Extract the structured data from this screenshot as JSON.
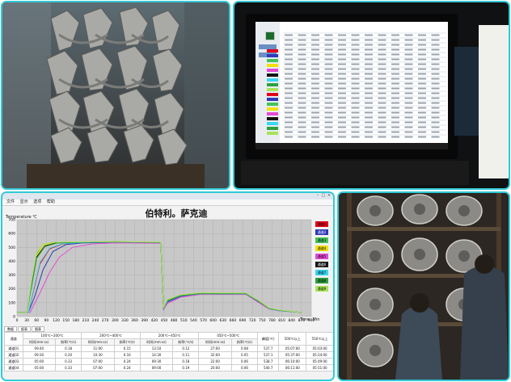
{
  "chart_window": {
    "titlebar_text": "",
    "menu_items": [
      "文件",
      "显示",
      "选项",
      "帮助"
    ],
    "chart_title": "伯特利。萨克迪",
    "y_axis_label": "Temperature ℃",
    "x_axis_label": "Time: Min",
    "tabs": [
      "数据",
      "报表",
      "图表"
    ],
    "legend": [
      {
        "label": "通道1",
        "color": "#e0001b"
      },
      {
        "label": "通道2",
        "color": "#2d39b8"
      },
      {
        "label": "通道3",
        "color": "#44c25a"
      },
      {
        "label": "通道4",
        "color": "#f1e10a"
      },
      {
        "label": "通道5",
        "color": "#e34ad8"
      },
      {
        "label": "通道6",
        "color": "#141414"
      },
      {
        "label": "通道7",
        "color": "#39d7f0"
      },
      {
        "label": "通道8",
        "color": "#2f9f3f"
      },
      {
        "label": "通道9",
        "color": "#a7e35a"
      }
    ],
    "table": {
      "group_headers": [
        "通道",
        "100℃~200℃",
        "200℃~400℃",
        "200℃~450℃",
        "450℃~500℃",
        "峰值(℃)",
        "500℃以上",
        "550℃以上"
      ],
      "sub_headers": [
        "时间(mm:ss)",
        "斜率(℃/s)",
        "时间(mm:ss)",
        "斜率(℃/s)",
        "时间(mm:ss)",
        "斜率(℃/s)",
        "时间(mm:ss)",
        "斜率(℃/s)"
      ],
      "rows": [
        [
          "通道01",
          "09:40",
          "0.18",
          "11:00",
          "0.15",
          "13:10",
          "0.12",
          "27:00",
          "0.08",
          "537.7",
          "05:07:00",
          "05:03:00"
        ],
        [
          "通道02",
          "09:30",
          "0.20",
          "10:30",
          "0.16",
          "14:30",
          "0.11",
          "32:00",
          "0.05",
          "537.1",
          "05:37:00",
          "05:24:00"
        ],
        [
          "通道03",
          "05:00",
          "0.33",
          "07:00",
          "0.24",
          "09:30",
          "0.18",
          "22:00",
          "0.06",
          "538.7",
          "06:10:00",
          "05:49:00"
        ],
        [
          "通道04",
          "05:00",
          "0.33",
          "07:00",
          "0.24",
          "09:00",
          "0.19",
          "20:00",
          "0.06",
          "540.7",
          "06:11:00",
          "05:51:00"
        ]
      ]
    }
  },
  "chart_data": {
    "type": "line",
    "title": "伯特利。萨克迪",
    "ylabel": "Temperature ℃",
    "xlabel": "Time: Min",
    "xlim": [
      0,
      900
    ],
    "ylim": [
      0,
      700
    ],
    "x_ticks": [
      0,
      30,
      60,
      90,
      120,
      150,
      180,
      210,
      240,
      270,
      300,
      330,
      360,
      390,
      420,
      450,
      480,
      510,
      540,
      570,
      600,
      630,
      660,
      690,
      720,
      750,
      780,
      810,
      840,
      870,
      900
    ],
    "y_ticks": [
      0,
      100,
      200,
      300,
      400,
      500,
      600,
      700
    ],
    "grid": true,
    "legend_position": "right",
    "series": [
      {
        "name": "通道1",
        "color": "#e0001b",
        "x": [
          0,
          35,
          50,
          70,
          100,
          140,
          200,
          300,
          440,
          448,
          460,
          500,
          560,
          700,
          740,
          770,
          800,
          870
        ],
        "y": [
          30,
          30,
          180,
          380,
          490,
          525,
          535,
          540,
          535,
          60,
          110,
          150,
          165,
          165,
          110,
          60,
          45,
          30
        ]
      },
      {
        "name": "通道2",
        "color": "#2d39b8",
        "x": [
          0,
          35,
          55,
          80,
          110,
          150,
          200,
          300,
          440,
          448,
          460,
          500,
          560,
          700,
          740,
          770,
          800,
          870
        ],
        "y": [
          30,
          30,
          150,
          340,
          470,
          520,
          532,
          536,
          532,
          55,
          105,
          145,
          162,
          163,
          105,
          58,
          43,
          30
        ]
      },
      {
        "name": "通道3",
        "color": "#44c25a",
        "x": [
          0,
          30,
          45,
          60,
          80,
          110,
          160,
          300,
          440,
          448,
          460,
          500,
          560,
          700,
          740,
          770,
          800,
          870
        ],
        "y": [
          30,
          30,
          250,
          450,
          520,
          535,
          538,
          540,
          536,
          60,
          120,
          155,
          168,
          168,
          112,
          62,
          46,
          30
        ]
      },
      {
        "name": "通道4",
        "color": "#f1e10a",
        "x": [
          0,
          30,
          45,
          60,
          80,
          110,
          160,
          300,
          440,
          448,
          460,
          500,
          560,
          700,
          740,
          770,
          800,
          870
        ],
        "y": [
          30,
          30,
          240,
          440,
          515,
          534,
          538,
          541,
          537,
          62,
          118,
          156,
          170,
          169,
          114,
          63,
          47,
          30
        ]
      },
      {
        "name": "通道5",
        "color": "#e34ad8",
        "x": [
          0,
          40,
          70,
          100,
          130,
          170,
          230,
          300,
          440,
          448,
          460,
          500,
          560,
          700,
          740,
          770,
          800,
          870
        ],
        "y": [
          30,
          30,
          170,
          320,
          430,
          500,
          525,
          532,
          530,
          50,
          95,
          140,
          160,
          160,
          100,
          55,
          42,
          30
        ]
      },
      {
        "name": "通道6",
        "color": "#141414",
        "x": [
          0,
          30,
          45,
          60,
          85,
          120,
          170,
          300,
          440,
          448,
          460,
          500,
          560,
          700,
          740,
          770,
          800,
          870
        ],
        "y": [
          30,
          30,
          230,
          430,
          510,
          532,
          537,
          540,
          536,
          58,
          115,
          152,
          166,
          166,
          110,
          60,
          45,
          30
        ]
      },
      {
        "name": "通道7",
        "color": "#39d7f0",
        "x": [
          0,
          35,
          50,
          70,
          100,
          140,
          200,
          300,
          440,
          448,
          460,
          500,
          560,
          700,
          740,
          770,
          800,
          870
        ],
        "y": [
          30,
          30,
          190,
          390,
          495,
          527,
          535,
          539,
          535,
          57,
          112,
          150,
          164,
          164,
          108,
          59,
          44,
          30
        ]
      },
      {
        "name": "通道8",
        "color": "#2f9f3f",
        "x": [
          0,
          30,
          45,
          60,
          85,
          120,
          170,
          300,
          440,
          448,
          460,
          500,
          560,
          700,
          740,
          770,
          800,
          870
        ],
        "y": [
          30,
          30,
          220,
          420,
          505,
          530,
          536,
          539,
          535,
          59,
          114,
          151,
          165,
          165,
          109,
          60,
          45,
          30
        ]
      },
      {
        "name": "通道9",
        "color": "#a7e35a",
        "x": [
          0,
          30,
          45,
          60,
          80,
          110,
          160,
          300,
          440,
          448,
          460,
          500,
          560,
          700,
          740,
          770,
          800,
          870
        ],
        "y": [
          30,
          30,
          260,
          460,
          522,
          536,
          539,
          542,
          538,
          63,
          122,
          157,
          171,
          170,
          115,
          64,
          48,
          30
        ]
      }
    ]
  },
  "colors": {
    "frame_border": "#31c9d6",
    "plot_background": "#c8c8c8",
    "grid": "#b0b0b0"
  }
}
